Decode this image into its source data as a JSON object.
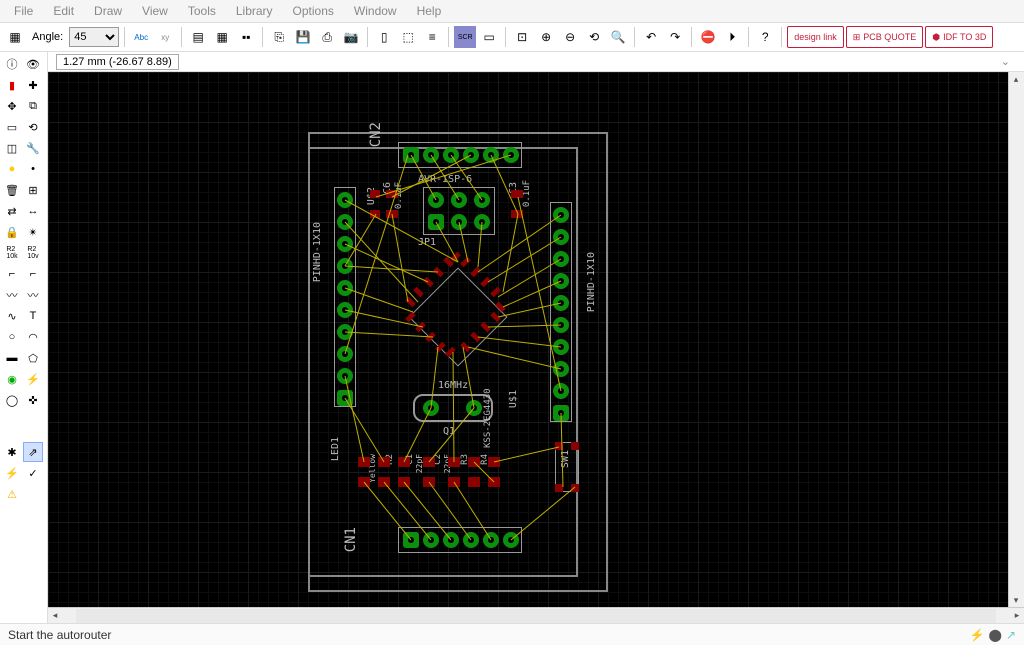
{
  "menu": [
    "File",
    "Edit",
    "Draw",
    "View",
    "Tools",
    "Library",
    "Options",
    "Window",
    "Help"
  ],
  "toolbar": {
    "angle_label": "Angle:",
    "angle_value": "45",
    "big_buttons": [
      "design link",
      "PCB QUOTE",
      "IDF TO 3D"
    ]
  },
  "coords": "1.27 mm (-26.67 8.89)",
  "status": "Start the autorouter",
  "pcb": {
    "labels": {
      "cn1": "CN1",
      "cn2": "CN2",
      "jp1": "JP1",
      "avr": "AVR-ISP-6",
      "q1": "Q1",
      "freq": "16MHz",
      "led1": "LED1",
      "pinhd_left": "PINHD-1X10",
      "pinhd_right": "PINHD-1X10",
      "us1": "U$1",
      "us2": "U$2",
      "sw1": "SW1",
      "kss": "KSS-2EG4430",
      "yellow": "Yellow",
      "c3": "C3",
      "c3v": "0.1uF",
      "c6": "C6",
      "c6v": "0.1uF",
      "c1": "C1",
      "c2": "C2",
      "c1v": "22pF",
      "c2v": "22pF",
      "r2": "R2",
      "r3": "R3",
      "r4": "R4"
    }
  }
}
